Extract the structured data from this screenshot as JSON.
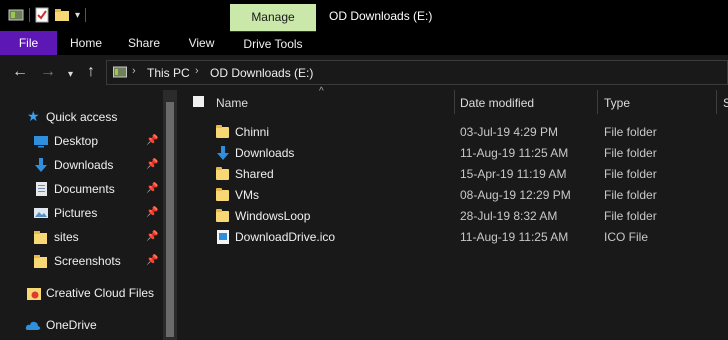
{
  "window": {
    "title": "OD Downloads  (E:)",
    "contextual_tab": "Manage"
  },
  "ribbon": {
    "tabs": [
      "File",
      "Home",
      "Share",
      "View",
      "Drive Tools"
    ]
  },
  "address": {
    "crumbs": [
      "This PC",
      "OD Downloads  (E:)"
    ]
  },
  "sidebar": {
    "quick_access": "Quick access",
    "items": [
      {
        "label": "Desktop",
        "icon": "desktop-icon",
        "pinned": true
      },
      {
        "label": "Downloads",
        "icon": "download-arrow-icon",
        "pinned": true
      },
      {
        "label": "Documents",
        "icon": "documents-icon",
        "pinned": true
      },
      {
        "label": "Pictures",
        "icon": "pictures-icon",
        "pinned": true
      },
      {
        "label": "sites",
        "icon": "folder-icon",
        "pinned": true
      },
      {
        "label": "Screenshots",
        "icon": "folder-icon",
        "pinned": true
      }
    ],
    "creative_cloud": "Creative Cloud Files",
    "onedrive": "OneDrive"
  },
  "columns": {
    "name": "Name",
    "date": "Date modified",
    "type": "Type"
  },
  "files": [
    {
      "name": "Chinni",
      "date": "03-Jul-19 4:29 PM",
      "type": "File folder",
      "icon": "folder-icon"
    },
    {
      "name": "Downloads",
      "date": "11-Aug-19 11:25 AM",
      "type": "File folder",
      "icon": "download-arrow-icon"
    },
    {
      "name": "Shared",
      "date": "15-Apr-19 11:19 AM",
      "type": "File folder",
      "icon": "folder-icon"
    },
    {
      "name": "VMs",
      "date": "08-Aug-19 12:29 PM",
      "type": "File folder",
      "icon": "folder-icon"
    },
    {
      "name": "WindowsLoop",
      "date": "28-Jul-19 8:32 AM",
      "type": "File folder",
      "icon": "folder-icon"
    },
    {
      "name": "DownloadDrive.ico",
      "date": "11-Aug-19 11:25 AM",
      "type": "ICO File",
      "icon": "ico-file-icon"
    }
  ],
  "colors": {
    "file_tab": "#5c17b4",
    "manage_tab": "#c9e8a9",
    "background": "#191919",
    "folder": "#f8d775",
    "quick_access_star": "#3aa0f0"
  }
}
